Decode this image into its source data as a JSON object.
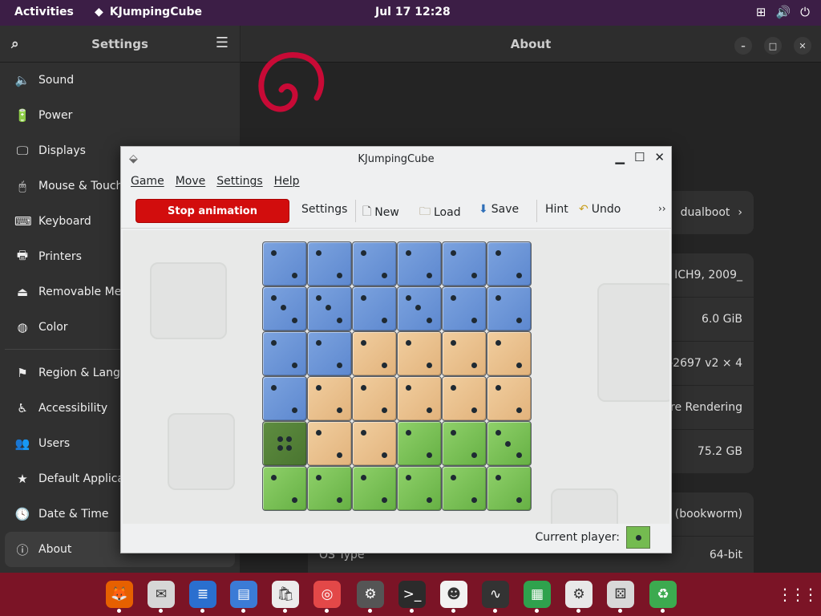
{
  "topbar": {
    "activities": "Activities",
    "app_name": "KJumpingCube",
    "clock": "Jul 17  12:28"
  },
  "settings": {
    "sidebar_title": "Settings",
    "items": [
      {
        "label": "Sound",
        "icon": "speaker-icon",
        "glyph": "🔈"
      },
      {
        "label": "Power",
        "icon": "power-icon",
        "glyph": "🔋"
      },
      {
        "label": "Displays",
        "icon": "display-icon",
        "glyph": "🖵"
      },
      {
        "label": "Mouse & Touchpad",
        "icon": "mouse-icon",
        "glyph": "🖱"
      },
      {
        "label": "Keyboard",
        "icon": "keyboard-icon",
        "glyph": "⌨"
      },
      {
        "label": "Printers",
        "icon": "printer-icon",
        "glyph": "🖶"
      },
      {
        "label": "Removable Media",
        "icon": "usb-icon",
        "glyph": "⏏"
      },
      {
        "label": "Color",
        "icon": "color-icon",
        "glyph": "◍"
      },
      {
        "label": "Region & Language",
        "icon": "flag-icon",
        "glyph": "⚑"
      },
      {
        "label": "Accessibility",
        "icon": "accessibility-icon",
        "glyph": "♿"
      },
      {
        "label": "Users",
        "icon": "users-icon",
        "glyph": "👥"
      },
      {
        "label": "Default Applications",
        "icon": "star-icon",
        "glyph": "★"
      },
      {
        "label": "Date & Time",
        "icon": "clock-icon",
        "glyph": "🕓"
      },
      {
        "label": "About",
        "icon": "info-icon",
        "glyph": "ⓘ"
      }
    ],
    "main_title": "About",
    "device_name": "dualboot",
    "rows": [
      {
        "value": "ICH9, 2009_"
      },
      {
        "value": "6.0 GiB"
      },
      {
        "value": "E5-2697 v2 × 4"
      },
      {
        "value": "Software Rendering"
      },
      {
        "value": "75.2 GB"
      },
      {
        "value": "12 (bookworm)"
      }
    ],
    "os_type_label": "OS Type",
    "os_type_value": "64-bit"
  },
  "kjc": {
    "title": "KJumpingCube",
    "menus": [
      "Game",
      "Move",
      "Settings",
      "Help"
    ],
    "toolbar": {
      "stop": "Stop animation",
      "settings": "Settings",
      "new": "New",
      "load": "Load",
      "save": "Save",
      "hint": "Hint",
      "undo": "Undo",
      "more": "››"
    },
    "status_label": "Current player:",
    "board": [
      [
        [
          "blue",
          1
        ],
        [
          "blue",
          1
        ],
        [
          "blue",
          1
        ],
        [
          "blue",
          1
        ],
        [
          "blue",
          1
        ],
        [
          "blue",
          1
        ]
      ],
      [
        [
          "blue",
          2
        ],
        [
          "blue",
          2
        ],
        [
          "blue",
          1
        ],
        [
          "blue",
          2
        ],
        [
          "blue",
          1
        ],
        [
          "blue",
          1
        ]
      ],
      [
        [
          "blue",
          1
        ],
        [
          "blue",
          1
        ],
        [
          "orange",
          1
        ],
        [
          "orange",
          1
        ],
        [
          "orange",
          1
        ],
        [
          "orange",
          1
        ]
      ],
      [
        [
          "blue",
          1
        ],
        [
          "orange",
          1
        ],
        [
          "orange",
          1
        ],
        [
          "orange",
          1
        ],
        [
          "orange",
          1
        ],
        [
          "orange",
          1
        ]
      ],
      [
        [
          "dark",
          4
        ],
        [
          "orange",
          1
        ],
        [
          "orange",
          1
        ],
        [
          "green",
          1
        ],
        [
          "green",
          1
        ],
        [
          "green",
          2
        ]
      ],
      [
        [
          "green",
          1
        ],
        [
          "green",
          1
        ],
        [
          "green",
          1
        ],
        [
          "green",
          1
        ],
        [
          "green",
          1
        ],
        [
          "green",
          1
        ]
      ]
    ]
  },
  "dock_apps": [
    {
      "icon": "firefox-icon",
      "glyph": "🦊",
      "bg": "#e66000"
    },
    {
      "icon": "evolution-icon",
      "glyph": "✉",
      "bg": "#d6d6d6"
    },
    {
      "icon": "writer-icon",
      "glyph": "≣",
      "bg": "#2a6fcf"
    },
    {
      "icon": "files-icon",
      "glyph": "▤",
      "bg": "#3b7bd6"
    },
    {
      "icon": "software-icon",
      "glyph": "🛍",
      "bg": "#ececec"
    },
    {
      "icon": "help-icon",
      "glyph": "◎",
      "bg": "#e34848"
    },
    {
      "icon": "tweaks-icon",
      "glyph": "⚙",
      "bg": "#555555"
    },
    {
      "icon": "terminal-icon",
      "glyph": ">_",
      "bg": "#2b2b2b"
    },
    {
      "icon": "robot-icon",
      "glyph": "☻",
      "bg": "#f2f2f2"
    },
    {
      "icon": "wave-icon",
      "glyph": "∿",
      "bg": "#333333"
    },
    {
      "icon": "board-game-icon",
      "glyph": "▦",
      "bg": "#2fa24d"
    },
    {
      "icon": "settings-icon",
      "glyph": "⚙",
      "bg": "#e8e8e8"
    },
    {
      "icon": "kjumpingcube-icon",
      "glyph": "⚄",
      "bg": "#d8d8d8"
    },
    {
      "icon": "recycle-icon",
      "glyph": "♻",
      "bg": "#3caa4f"
    }
  ]
}
